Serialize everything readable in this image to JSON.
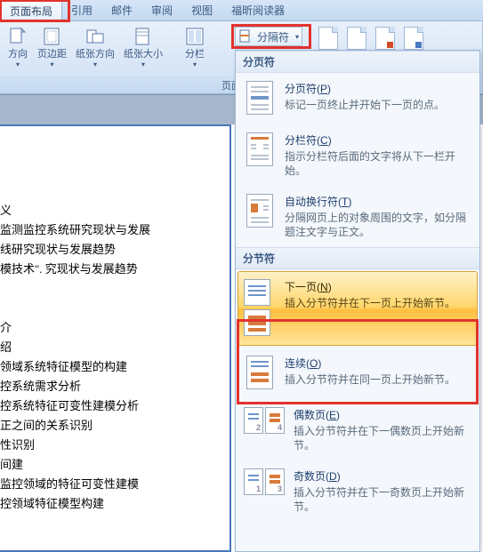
{
  "tabs": {
    "active": "页面布局",
    "items": [
      "页面布局",
      "引用",
      "邮件",
      "审阅",
      "视图",
      "福昕阅读器"
    ]
  },
  "ribbon": {
    "buttons": [
      {
        "label": "方向",
        "name": "orientation"
      },
      {
        "label": "页边距",
        "name": "margins"
      },
      {
        "label": "纸张方向",
        "name": "paper-orientation"
      },
      {
        "label": "纸张大小",
        "name": "paper-size"
      }
    ],
    "columns_label": "分栏",
    "group_caption": "页面设置"
  },
  "breaks_button": "分隔符",
  "dropdown": {
    "section1": {
      "header": "分页符",
      "items": [
        {
          "title": "分页符",
          "mn": "P",
          "desc": "标记一页终止并开始下一页的点。",
          "name": "page-break"
        },
        {
          "title": "分栏符",
          "mn": "C",
          "desc": "指示分栏符后面的文字将从下一栏开始。",
          "name": "column-break"
        },
        {
          "title": "自动换行符",
          "mn": "T",
          "desc": "分隔网页上的对象周围的文字，如分隔题注文字与正文。",
          "name": "text-wrapping-break"
        }
      ]
    },
    "section2": {
      "header": "分节符",
      "items": [
        {
          "title": "下一页",
          "mn": "N",
          "desc": "插入分节符并在下一页上开始新节。",
          "name": "next-page",
          "selected": true
        },
        {
          "title": "连续",
          "mn": "O",
          "desc": "插入分节符并在同一页上开始新节。",
          "name": "continuous"
        },
        {
          "title": "偶数页",
          "mn": "E",
          "desc": "插入分节符并在下一偶数页上开始新节。",
          "name": "even-page"
        },
        {
          "title": "奇数页",
          "mn": "D",
          "desc": "插入分节符并在下一奇数页上开始新节。",
          "name": "odd-page"
        }
      ]
    }
  },
  "document_lines": [
    "",
    "义",
    "监测监控系统研究现状与发展",
    "线研究现状与发展趋势",
    "模技术\". 究现状与发展趋势",
    "",
    "",
    "介",
    "绍",
    "领域系统特征模型的构建",
    "控系统需求分析",
    "控系统特征可变性建模分析",
    "正之间的关系识别",
    "性识别",
    "间建",
    "监控领域的特征可变性建模",
    "控领域特征模型构建"
  ]
}
